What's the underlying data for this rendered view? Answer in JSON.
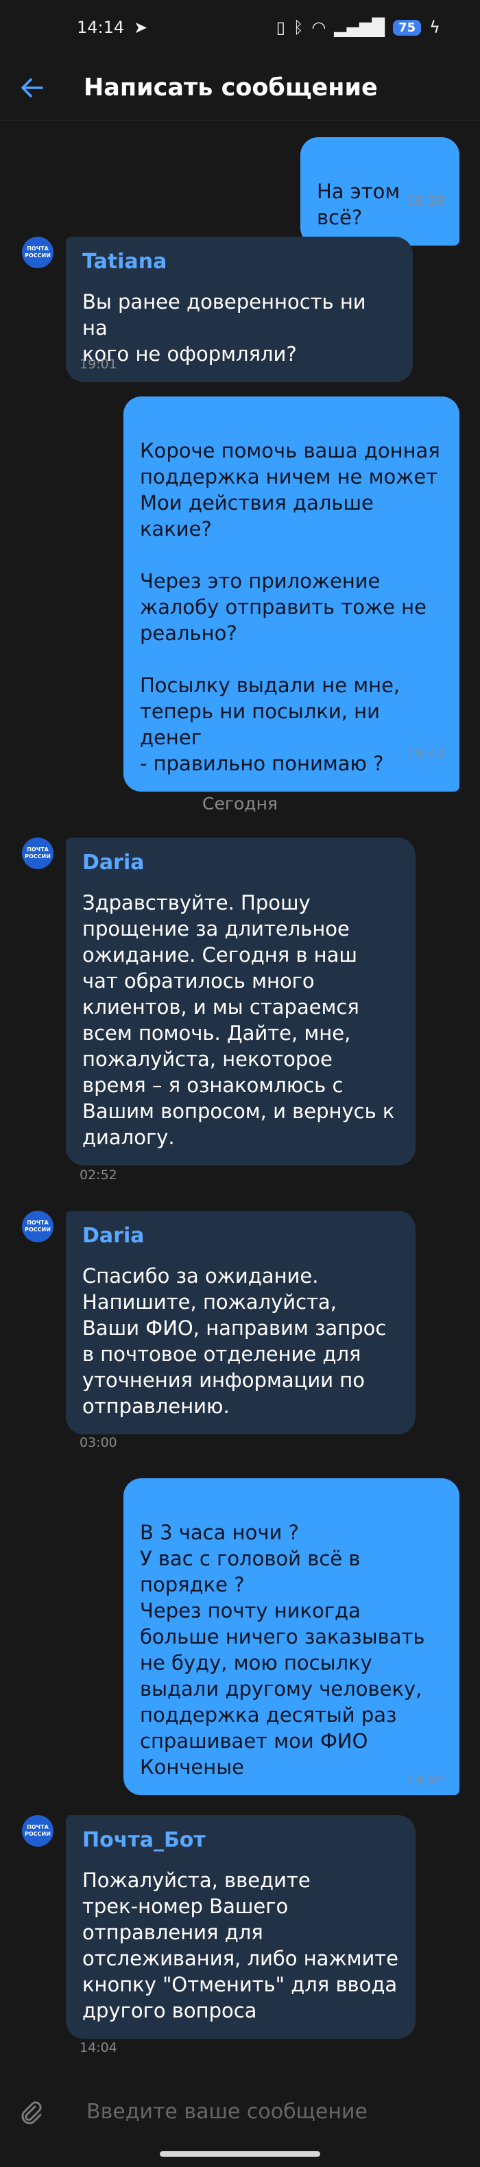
{
  "status_bar": {
    "time": "14:14",
    "battery": "75"
  },
  "header": {
    "title": "Написать сообщение",
    "back_icon": "arrow-left-icon"
  },
  "colors": {
    "accent": "#3aa0ff",
    "incoming_bubble": "#223246",
    "background": "#181818",
    "sender_name": "#5aa8ff"
  },
  "avatar": {
    "line1": "ПОЧТА",
    "line2": "РОССИИ"
  },
  "messages": [
    {
      "type": "out",
      "text": "На этом всё?",
      "time": "18:39"
    },
    {
      "type": "in",
      "sender": "Tatiana",
      "text": "Вы ранее доверенность ни на\nкого не оформляли?",
      "time": "19:01"
    },
    {
      "type": "out",
      "text": "Короче помочь ваша донная\nподдержка ничем не может\nМои действия дальше\nкакие?\n\nЧерез это приложение\nжалобу отправить тоже не\nреально?\n\nПосылку выдали не мне,\nтеперь ни посылки, ни денег\n- правильно понимаю ?",
      "time": "19:42"
    },
    {
      "type": "in",
      "sender": "Daria",
      "text": "Здравствуйте. Прошу\nпрощение за длительное\nожидание. Сегодня в наш\nчат обратилось много\nклиентов, и мы стараемся\nвсем помочь. Дайте, мне,\nпожалуйста, некоторое\nвремя – я ознакомлюсь с\nВашим вопросом, и вернусь к\nдиалогу.",
      "time": "02:52"
    },
    {
      "type": "in",
      "sender": "Daria",
      "text": "Спасибо за ожидание.\nНапишите, пожалуйста,\nВаши ФИО, направим запрос\nв почтовое отделение для\nуточнения информации по\nотправлению.",
      "time": "03:00"
    },
    {
      "type": "out",
      "text": "В 3 часа ночи ?\nУ вас с головой всё в\nпорядке ?\nЧерез почту никогда\nбольше ничего заказывать\nне буду, мою посылку\nвыдали другому человеку,\nподдержка десятый раз\nспрашивает мои ФИО\nКонченые",
      "time": "14:04"
    },
    {
      "type": "in",
      "sender": "Почта_Бот",
      "text": "Пожалуйста, введите\nтрек-номер Вашего\nотправления для\nотслеживания, либо нажмите\nкнопку \"Отменить\" для ввода\nдругого вопроса",
      "time": "14:04"
    }
  ],
  "date_separator": "Сегодня",
  "composer": {
    "placeholder": "Введите ваше сообщение",
    "attach_icon": "paperclip-icon"
  }
}
